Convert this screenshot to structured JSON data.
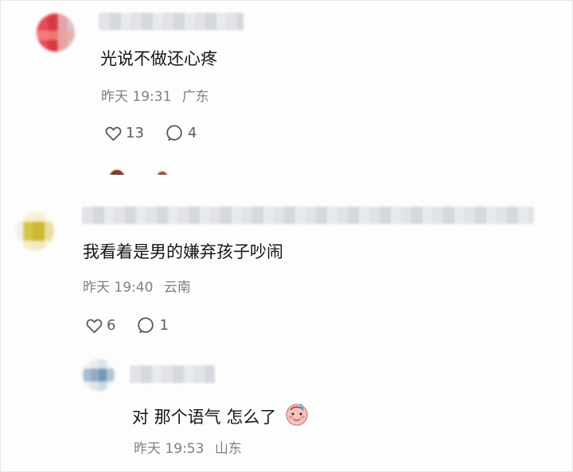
{
  "comments": [
    {
      "text": "光说不做还心疼",
      "time": "昨天 19:31",
      "location": "广东",
      "likes": "13",
      "replies": "4"
    },
    {
      "text": "我看着是男的嫌弃孩子吵闹",
      "time": "昨天 19:40",
      "location": "云南",
      "likes": "6",
      "replies": "1"
    },
    {
      "text": "对 那个语气 怎么了",
      "time": "昨天 19:53",
      "location": "山东"
    }
  ],
  "icons": {
    "like": "heart-outline-icon",
    "reply": "speech-bubble-icon",
    "emoji": "blushing-face-emoji"
  },
  "colors": {
    "background": "#fdfdfd",
    "text": "#161616",
    "meta": "#7f8084"
  }
}
